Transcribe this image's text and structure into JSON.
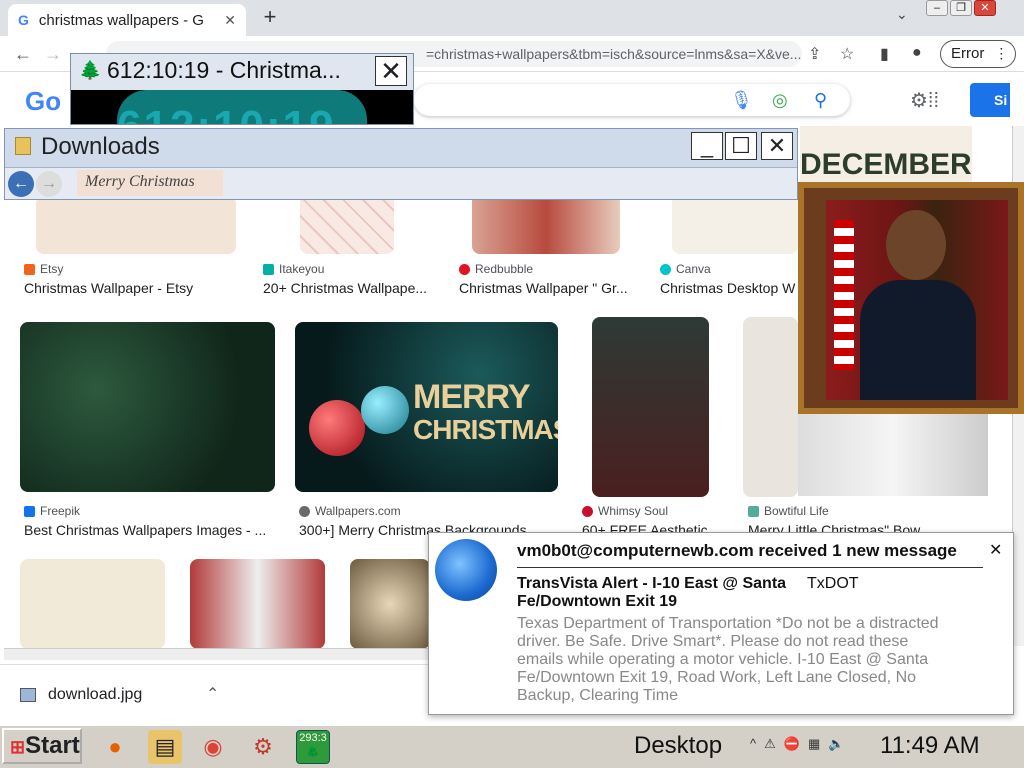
{
  "browser": {
    "tab_title": "christmas wallpapers - G",
    "url_text": "=christmas+wallpapers&tbm=isch&source=lnms&sa=X&ve...",
    "profile_label": "Error"
  },
  "search": {
    "signin_label": "Si"
  },
  "clock_window": {
    "title": "612:10:19 - Christma...",
    "display": "612:10:19"
  },
  "downloads_window": {
    "title": "Downloads",
    "preview_text": "Merry Christmas"
  },
  "results": [
    {
      "source": "Etsy",
      "caption": "Christmas Wallpaper - Etsy",
      "color": "#f1641e"
    },
    {
      "source": "Itakeyou",
      "caption": "20+ Christmas Wallpape...",
      "color": "#00b0a0"
    },
    {
      "source": "Redbubble",
      "caption": "Christmas Wallpaper \" Gr...",
      "color": "#e41321"
    },
    {
      "source": "Canva",
      "caption": "Christmas Desktop W",
      "color": "#00c4cc"
    },
    {
      "source": "Freepik",
      "caption": "Best Christmas Wallpapers Images - ...",
      "color": "#1273eb"
    },
    {
      "source": "Wallpapers.com",
      "caption": "300+] Merry Christmas Backgrounds",
      "color": "#6a6a6a"
    },
    {
      "source": "Whimsy Soul",
      "caption": "60+ FREE Aesthetic",
      "color": "#c8102e"
    },
    {
      "source": "Bowtiful Life",
      "caption": "Merry Little Christmas\" Bow",
      "color": "#5a9"
    }
  ],
  "image_text": {
    "merry": "MERRY",
    "christmas": "CHRISTMAS",
    "december": "DECEMBER"
  },
  "download_shelf": {
    "file": "download.jpg"
  },
  "notification": {
    "header": "vm0b0t@computernewb.com received 1 new message",
    "subject": "TransVista Alert - I-10 East @ Santa Fe/Downtown Exit 19",
    "from": "TxDOT",
    "body": "Texas Department of Transportation *Do not be a distracted driver. Be Safe. Drive Smart*. Please do not read these emails while operating a motor vehicle. I-10 East @ Santa Fe/Downtown Exit 19, Road Work, Left Lane Closed, No Backup, Clearing Time"
  },
  "taskbar": {
    "start_label": "Start",
    "tray_badge": "293:3",
    "desktop_label": "Desktop",
    "time": "11:49 AM"
  }
}
